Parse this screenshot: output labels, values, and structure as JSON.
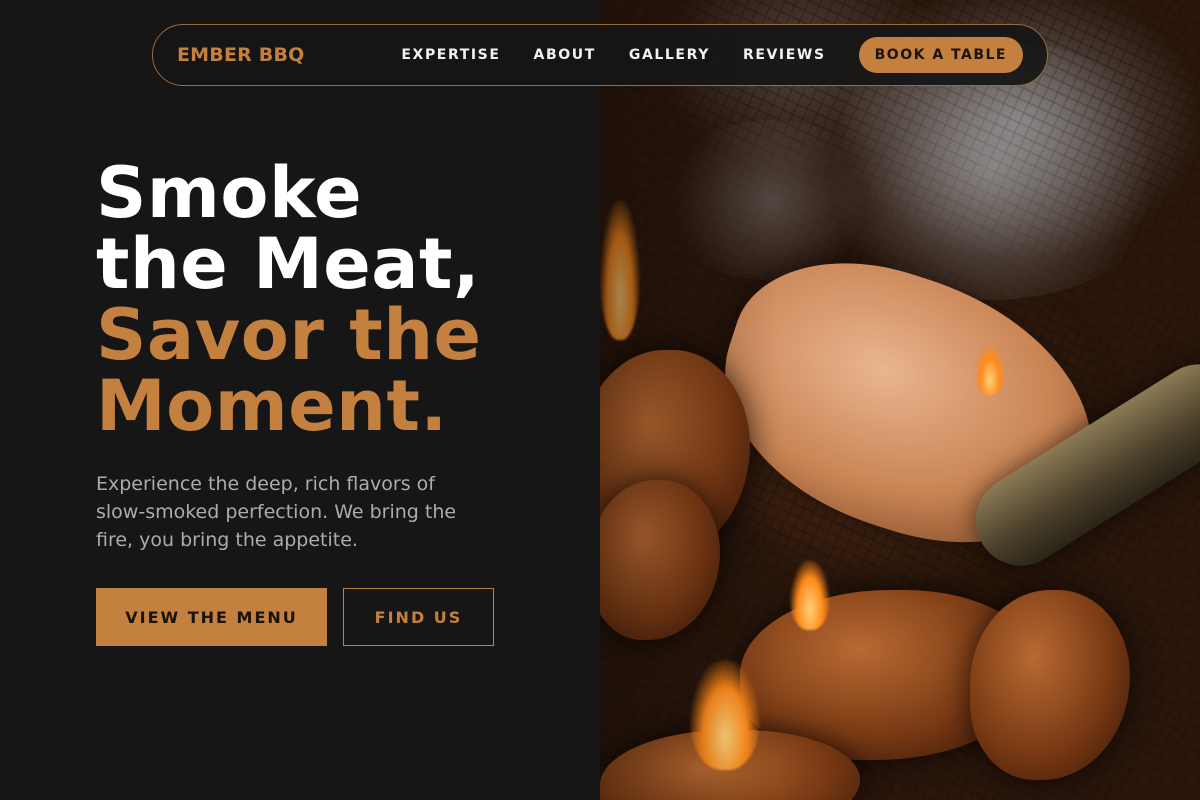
{
  "nav": {
    "brand": "EMBER BBQ",
    "links": [
      "EXPERTISE",
      "ABOUT",
      "GALLERY",
      "REVIEWS"
    ],
    "cta": "BOOK A TABLE"
  },
  "hero": {
    "headline_line1": "Smoke",
    "headline_line2": "the Meat,",
    "headline_accent_line1": "Savor the",
    "headline_accent_line2": "Moment.",
    "lede": "Experience the deep, rich flavors of slow-smoked perfection. We bring the fire, you bring the appetite.",
    "primary_button": "VIEW THE MENU",
    "secondary_button": "FIND US"
  },
  "colors": {
    "accent": "#c4803f",
    "background": "#161616",
    "text": "#ffffff",
    "muted": "#a9acb2"
  }
}
